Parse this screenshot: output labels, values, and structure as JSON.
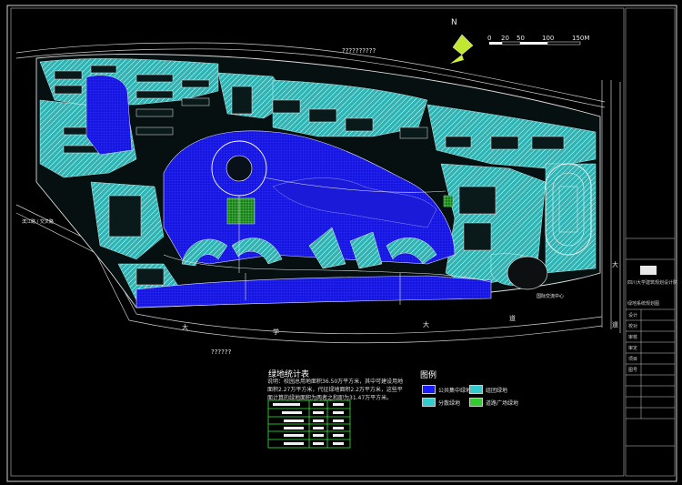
{
  "north_label": "N",
  "scale_bar": {
    "ticks": [
      "0",
      "20",
      "50",
      "100",
      "150M"
    ]
  },
  "place_labels": {
    "top_unknown": "??????????",
    "bottom_unknown": "??????",
    "left_road": "滨江路 / 交叉路",
    "right_road_bottom": "国际交流中心",
    "main_road_right": "大",
    "main_road_right2": "道",
    "road_bottom_1": "大",
    "road_bottom_2": "学",
    "road_bottom_3": "大",
    "road_bottom_4": "道"
  },
  "stats": {
    "title": "绿地统计表",
    "text": "说明：校园总用地面积36.50万平方米，其中可建设用地面积2.27万平方米，代征绿地面积2.2万平方米，这些平面计算的绿地面积为两者之和即为31.47万平方米。",
    "rows": [
      [
        "",
        "",
        "",
        ""
      ],
      [
        "",
        "",
        "",
        ""
      ],
      [
        "",
        "",
        "",
        ""
      ],
      [
        "",
        "",
        "",
        ""
      ],
      [
        "",
        "",
        "",
        ""
      ],
      [
        "",
        "",
        "",
        ""
      ]
    ]
  },
  "legend": {
    "title": "图例",
    "items": [
      {
        "label": "公共集中绿地",
        "color": "#1a1aff"
      },
      {
        "label": "组团绿地",
        "color": "#33cccc"
      },
      {
        "label": "分散绿地",
        "color": "#33cccc"
      },
      {
        "label": "道路广场绿地",
        "color": "#33cc33"
      }
    ]
  },
  "title_block": {
    "institute": "四川大学建筑规划设计院",
    "drawing_name": "绿地系统规划图",
    "lines": [
      "设计",
      "校对",
      "审核",
      "审定",
      "项目",
      "图号"
    ]
  },
  "colors": {
    "public_green": "#1a1aff",
    "group_green": "#33cccc",
    "road_green": "#33cc33",
    "line": "#d8d8d8"
  }
}
